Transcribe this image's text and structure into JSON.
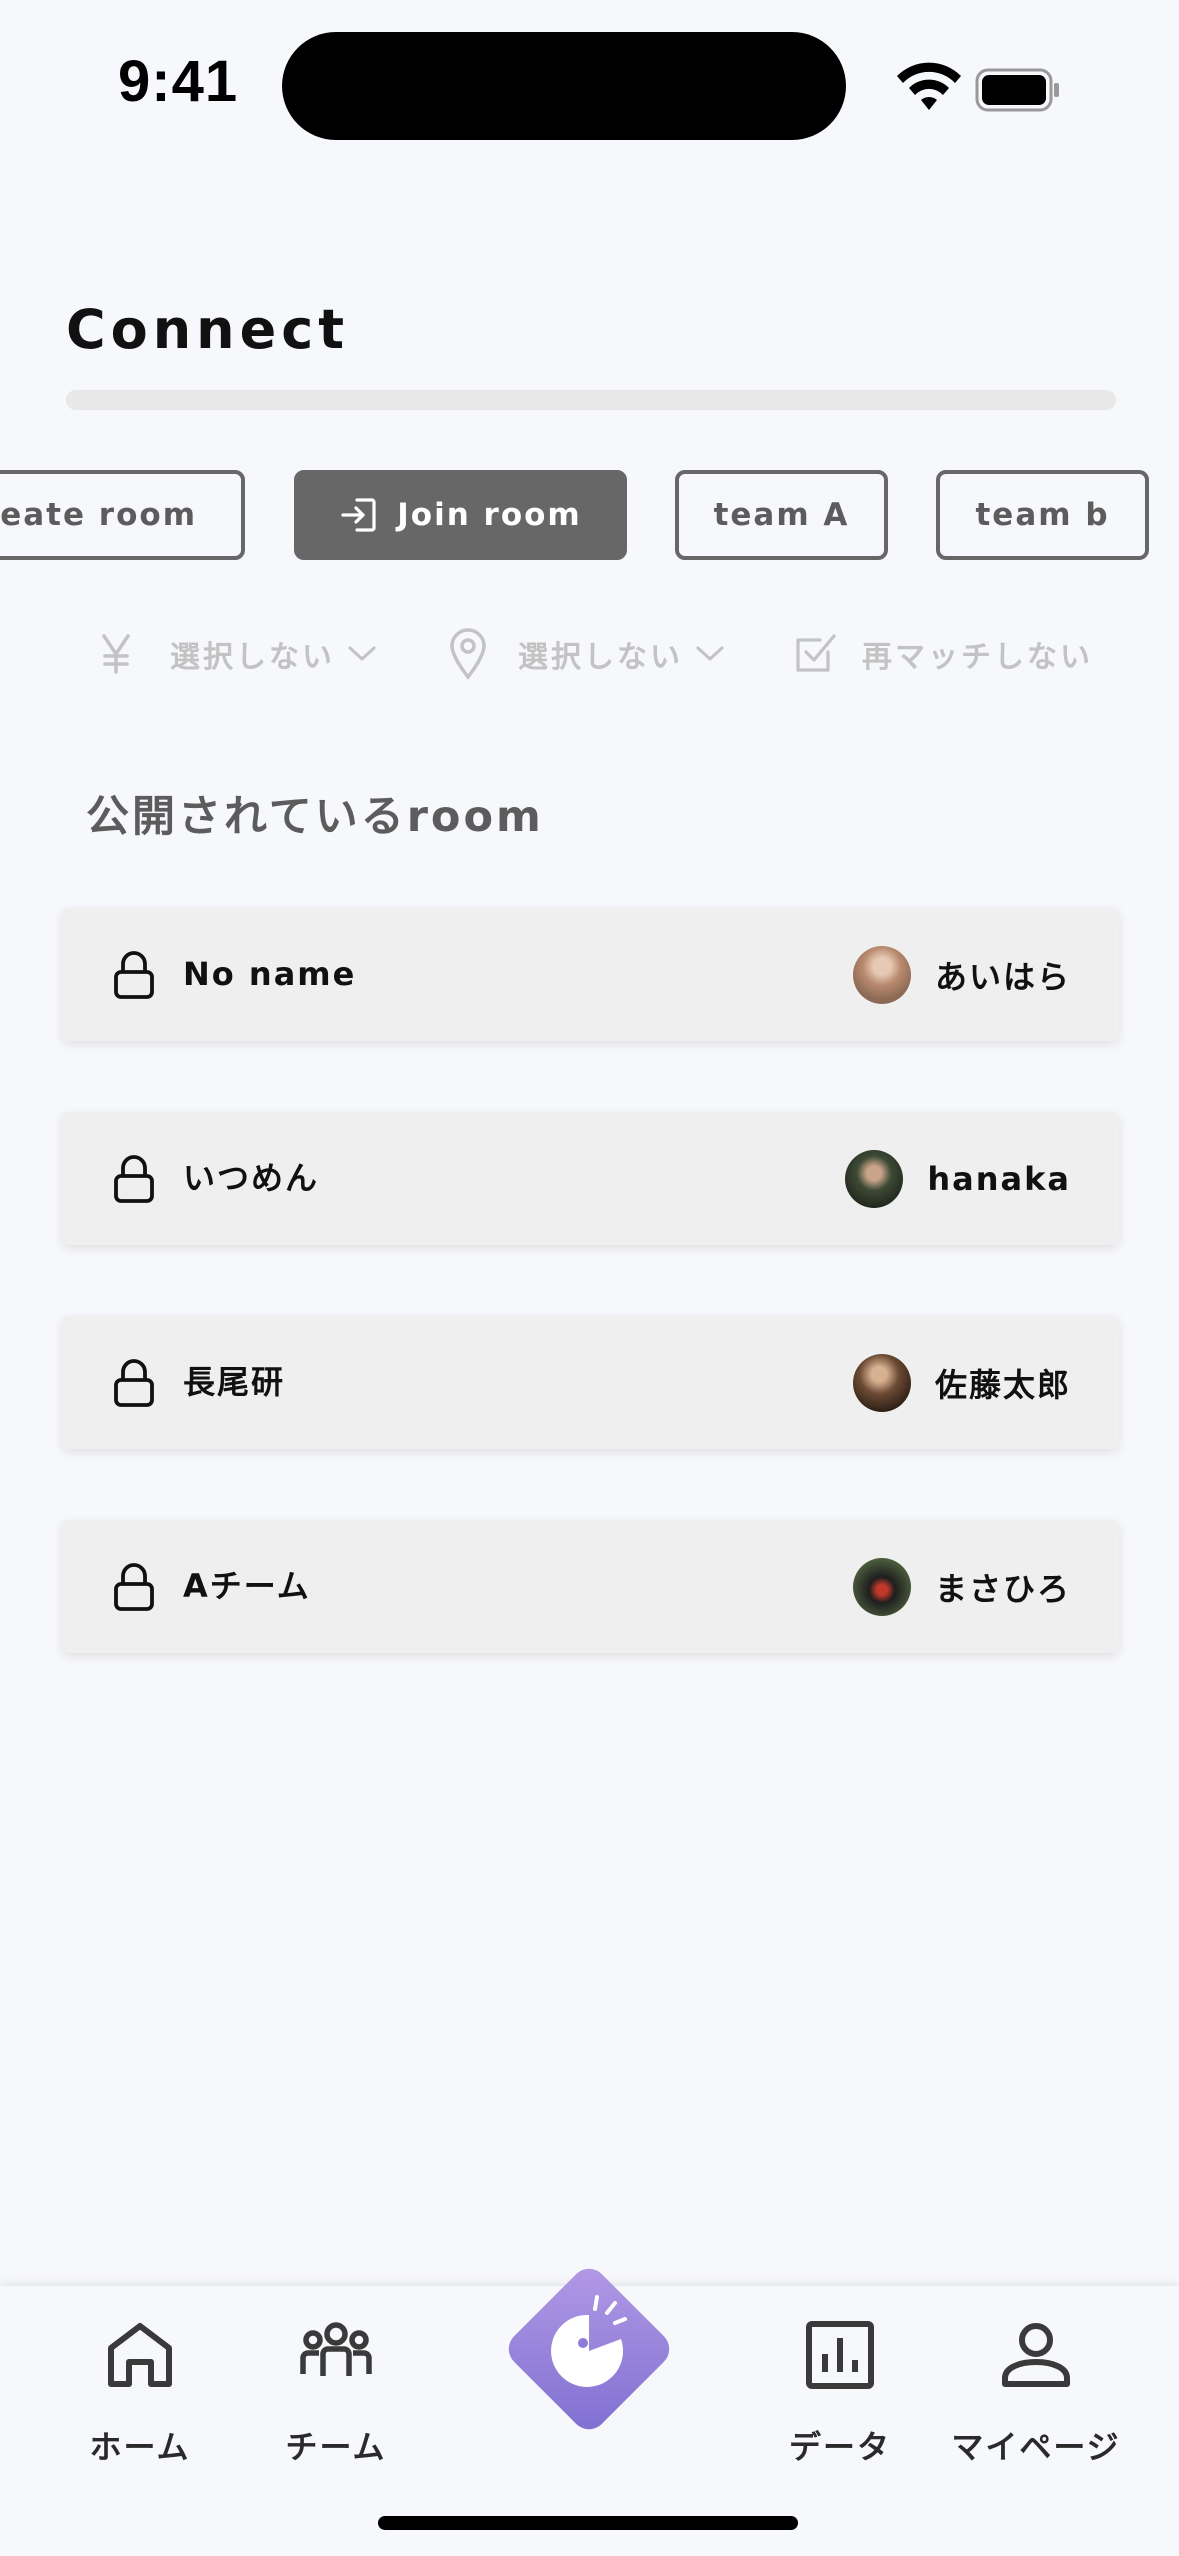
{
  "status_bar": {
    "time": "9:41"
  },
  "header": {
    "title": "Connect"
  },
  "actions": {
    "create_room": "Create room",
    "join_room": "Join room",
    "team_a": "team A",
    "team_b": "team b"
  },
  "filters": {
    "price": {
      "icon": "yen-icon",
      "value": "選択しない"
    },
    "place": {
      "icon": "location-pin-icon",
      "value": "選択しない"
    },
    "rematch": {
      "icon": "checkbox-icon",
      "value": "再マッチしない"
    }
  },
  "section": {
    "title": "公開されているroom"
  },
  "rooms": [
    {
      "name": "No name",
      "owner": "あいはら",
      "avatar_color": "#b88a6e"
    },
    {
      "name": "いつめん",
      "owner": "hanaka",
      "avatar_color": "#3d4a35"
    },
    {
      "name": "長尾研",
      "owner": "佐藤太郎",
      "avatar_color": "#6b4a33"
    },
    {
      "name": "Aチーム",
      "owner": "まさひろ",
      "avatar_color": "#2c3b2a"
    }
  ],
  "tabbar": {
    "home": "ホーム",
    "team": "チーム",
    "data": "データ",
    "mypage": "マイページ",
    "center_gradient": [
      "#b39ae6",
      "#7f6fd1"
    ]
  },
  "colors": {
    "background": "#f7f8fc",
    "button_dark": "#676767",
    "card": "#efefef"
  }
}
